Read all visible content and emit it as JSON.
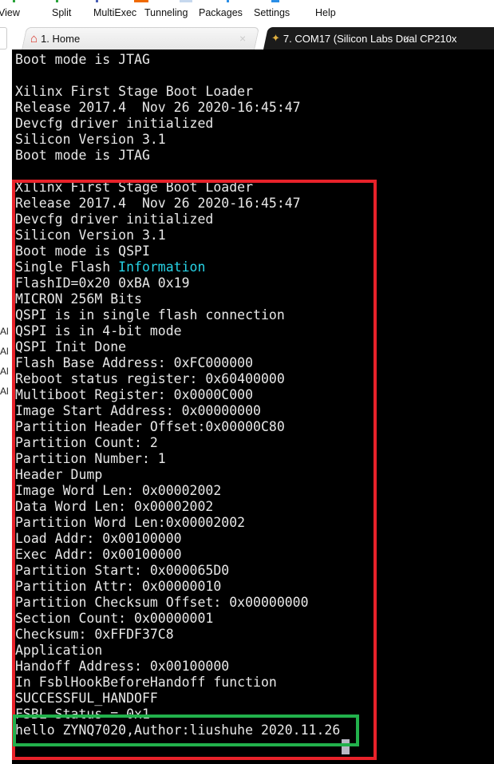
{
  "menu": [
    "View",
    "Split",
    "MultiExec",
    "Tunneling",
    "Packages",
    "Settings",
    "Help"
  ],
  "tabs": [
    {
      "label": "1. Home",
      "icon": "home-icon",
      "active": false
    },
    {
      "label": "7. COM17  (Silicon Labs Dual CP210x",
      "icon": "serial-plug-icon",
      "active": true
    }
  ],
  "sidebar_labels": [
    "Al",
    "Al",
    "Al",
    "Al"
  ],
  "terminal": {
    "lines": [
      "Boot mode is JTAG",
      "",
      "Xilinx First Stage Boot Loader",
      "Release 2017.4  Nov 26 2020-16:45:47",
      "Devcfg driver initialized",
      "Silicon Version 3.1",
      "Boot mode is JTAG",
      "",
      "Xilinx First Stage Boot Loader",
      "Release 2017.4  Nov 26 2020-16:45:47",
      "Devcfg driver initialized",
      "Silicon Version 3.1",
      "Boot mode is QSPI",
      "Single Flash |Information",
      "FlashID=0x20 0xBA 0x19",
      "MICRON 256M Bits",
      "QSPI is in single flash connection",
      "QSPI is in 4-bit mode",
      "QSPI Init Done",
      "Flash Base Address: 0xFC000000",
      "Reboot status register: 0x60400000",
      "Multiboot Register: 0x0000C000",
      "Image Start Address: 0x00000000",
      "Partition Header Offset:0x00000C80",
      "Partition Count: 2",
      "Partition Number: 1",
      "Header Dump",
      "Image Word Len: 0x00002002",
      "Data Word Len: 0x00002002",
      "Partition Word Len:0x00002002",
      "Load Addr: 0x00100000",
      "Exec Addr: 0x00100000",
      "Partition Start: 0x000065D0",
      "Partition Attr: 0x00000010",
      "Partition Checksum Offset: 0x00000000",
      "Section Count: 0x00000001",
      "Checksum: 0xFFDF37C8",
      "Application",
      "Handoff Address: 0x00100000",
      "In FsblHookBeforeHandoff function",
      "SUCCESSFUL_HANDOFF",
      "FSBL Status = 0x1",
      "hello ZYNQ7020,Author:liushuhe 2020.11.26"
    ],
    "highlight_color": "#27d3e6",
    "annotation_colors": {
      "red_box": "#e8222a",
      "green_box": "#22b14c"
    }
  }
}
